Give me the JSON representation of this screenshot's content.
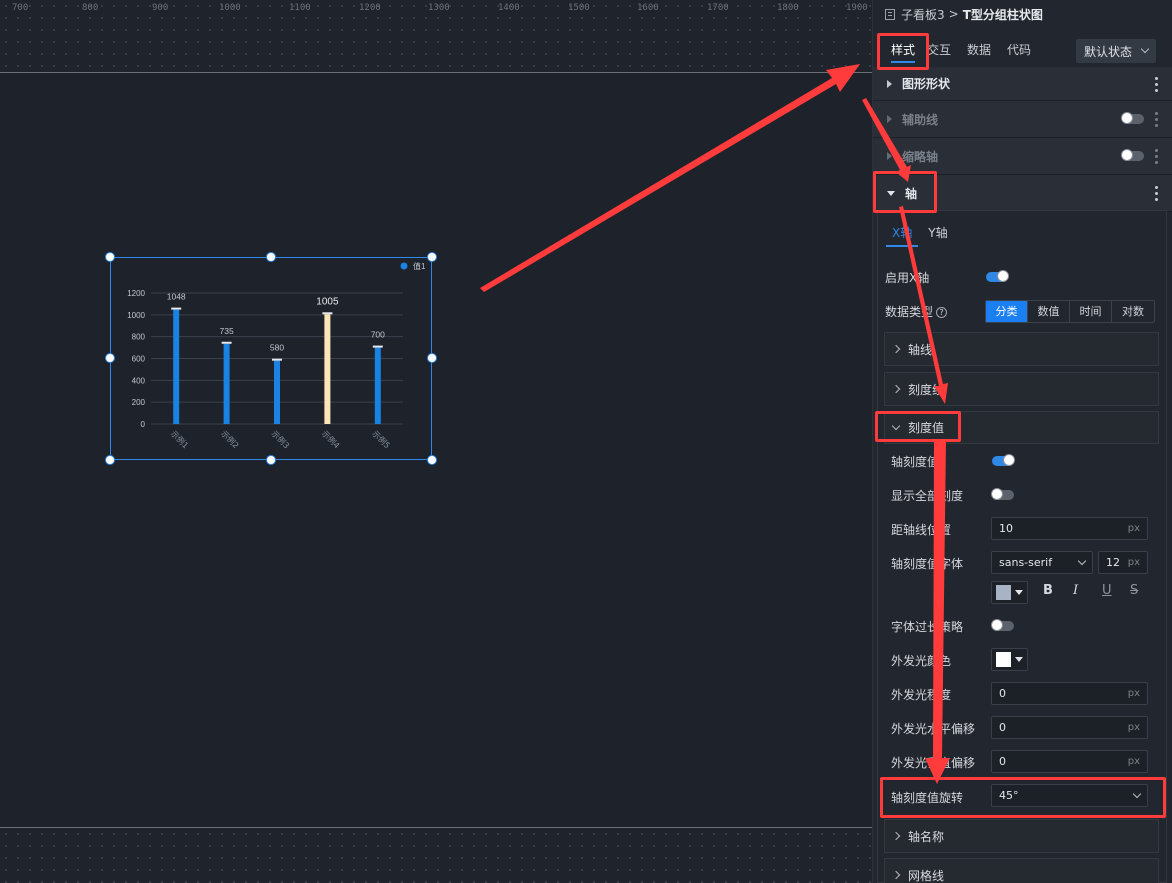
{
  "ruler": {
    "ticks": [
      "700",
      "800",
      "900",
      "1000",
      "1100",
      "1200",
      "1300",
      "1400",
      "1500",
      "1600",
      "1700",
      "1800",
      "1900"
    ]
  },
  "chart_data": {
    "type": "bar",
    "categories": [
      "示例1",
      "示例2",
      "示例3",
      "示例4",
      "示例5"
    ],
    "series": [
      {
        "name": "值1",
        "values": [
          1048,
          735,
          580,
          1005,
          700
        ]
      }
    ],
    "highlight_index": 3,
    "colors": {
      "bar": "#1a82e2",
      "highlight": "#fde5b5",
      "axis_text": "#8a929c",
      "grid": "#3b414b"
    },
    "yticks": [
      "0",
      "200",
      "400",
      "600",
      "800",
      "1000",
      "1200"
    ],
    "ylim": [
      0,
      1200
    ],
    "legend_position": "top-right",
    "x_label_rotation": 45,
    "grid": true
  },
  "panel": {
    "breadcrumb": {
      "parent": "子看板3",
      "separator": ">",
      "current": "T型分组柱状图"
    },
    "tabs": [
      "样式",
      "交互",
      "数据",
      "代码"
    ],
    "state_select": "默认状态",
    "sections": {
      "shape": "图形形状",
      "guide": "辅助线",
      "thumb_axis": "缩略轴",
      "axis": "轴"
    },
    "axis": {
      "subtabs": [
        "X轴",
        "Y轴"
      ],
      "enable_label": "启用X轴",
      "data_type_label": "数据类型",
      "help_glyph": "?",
      "data_types": [
        "分类",
        "数值",
        "时间",
        "对数"
      ],
      "groups": {
        "axis_line": "轴线",
        "tick_line": "刻度线",
        "tick_value": "刻度值",
        "axis_name": "轴名称",
        "grid_line": "网格线"
      },
      "tick_value": {
        "axis_tick_value_label": "轴刻度值",
        "show_all_label": "显示全部刻度",
        "distance_label": "距轴线位置",
        "distance_value": "10",
        "unit": "px",
        "font_label": "轴刻度值字体",
        "font_family": "sans-serif",
        "font_size": "12",
        "font_color": "#a9b3c6",
        "format_buttons": [
          "B",
          "I",
          "U",
          "S"
        ],
        "overflow_label": "字体过长策略",
        "glow_color_label": "外发光颜色",
        "glow_color": "#ffffff",
        "glow_blur_label": "外发光程度",
        "glow_blur_value": "0",
        "glow_x_label": "外发光水平偏移",
        "glow_x_value": "0",
        "glow_y_label": "外发光垂直偏移",
        "glow_y_value": "0",
        "rotate_label": "轴刻度值旋转",
        "rotate_value": "45°"
      }
    }
  }
}
